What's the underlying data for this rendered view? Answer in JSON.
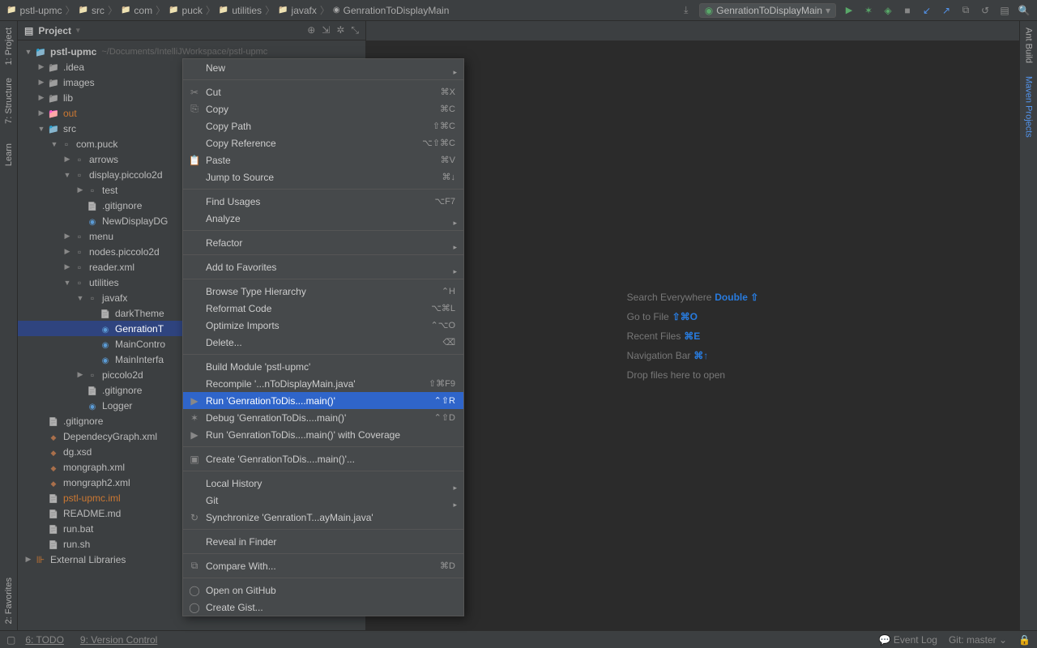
{
  "breadcrumbs": [
    "pstl-upmc",
    "src",
    "com",
    "puck",
    "utilities",
    "javafx",
    "GenrationToDisplayMain"
  ],
  "runConfig": "GenrationToDisplayMain",
  "leftGutter": [
    "1: Project",
    "7: Structure",
    "Learn",
    "2: Favorites"
  ],
  "rightGutter": [
    "Ant Build",
    "Maven Projects"
  ],
  "panelTitle": "Project",
  "tree": [
    {
      "d": 0,
      "a": "▼",
      "i": "folder-blue",
      "t": "pstl-upmc",
      "path": "~/Documents/IntelliJWorkspace/pstl-upmc",
      "bold": true
    },
    {
      "d": 1,
      "a": "▶",
      "i": "folder-icon",
      "t": ".idea"
    },
    {
      "d": 1,
      "a": "▶",
      "i": "folder-icon",
      "t": "images"
    },
    {
      "d": 1,
      "a": "▶",
      "i": "folder-icon",
      "t": "lib"
    },
    {
      "d": 1,
      "a": "▶",
      "i": "folder-orange",
      "t": "out",
      "orange": true
    },
    {
      "d": 1,
      "a": "▼",
      "i": "folder-blue",
      "t": "src"
    },
    {
      "d": 2,
      "a": "▼",
      "i": "pkg-icon",
      "t": "com.puck"
    },
    {
      "d": 3,
      "a": "▶",
      "i": "pkg-icon",
      "t": "arrows"
    },
    {
      "d": 3,
      "a": "▼",
      "i": "pkg-icon",
      "t": "display.piccolo2d"
    },
    {
      "d": 4,
      "a": "▶",
      "i": "pkg-icon",
      "t": "test"
    },
    {
      "d": 4,
      "a": "",
      "i": "file-icon",
      "t": ".gitignore"
    },
    {
      "d": 4,
      "a": "",
      "i": "java-icon",
      "t": "NewDisplayDG"
    },
    {
      "d": 3,
      "a": "▶",
      "i": "pkg-icon",
      "t": "menu"
    },
    {
      "d": 3,
      "a": "▶",
      "i": "pkg-icon",
      "t": "nodes.piccolo2d"
    },
    {
      "d": 3,
      "a": "▶",
      "i": "pkg-icon",
      "t": "reader.xml"
    },
    {
      "d": 3,
      "a": "▼",
      "i": "pkg-icon",
      "t": "utilities"
    },
    {
      "d": 4,
      "a": "▼",
      "i": "pkg-icon",
      "t": "javafx"
    },
    {
      "d": 5,
      "a": "",
      "i": "file-icon",
      "t": "darkTheme"
    },
    {
      "d": 5,
      "a": "",
      "i": "java-icon",
      "t": "GenrationT",
      "sel": true
    },
    {
      "d": 5,
      "a": "",
      "i": "java-icon",
      "t": "MainContro"
    },
    {
      "d": 5,
      "a": "",
      "i": "java-icon",
      "t": "MainInterfa"
    },
    {
      "d": 4,
      "a": "▶",
      "i": "pkg-icon",
      "t": "piccolo2d"
    },
    {
      "d": 4,
      "a": "",
      "i": "file-icon",
      "t": ".gitignore"
    },
    {
      "d": 4,
      "a": "",
      "i": "java-icon",
      "t": "Logger"
    },
    {
      "d": 1,
      "a": "",
      "i": "file-icon",
      "t": ".gitignore"
    },
    {
      "d": 1,
      "a": "",
      "i": "xml-icon",
      "t": "DependecyGraph.xml"
    },
    {
      "d": 1,
      "a": "",
      "i": "xml-icon",
      "t": "dg.xsd"
    },
    {
      "d": 1,
      "a": "",
      "i": "xml-icon",
      "t": "mongraph.xml"
    },
    {
      "d": 1,
      "a": "",
      "i": "xml-icon",
      "t": "mongraph2.xml"
    },
    {
      "d": 1,
      "a": "",
      "i": "file-icon",
      "t": "pstl-upmc.iml",
      "orange": true
    },
    {
      "d": 1,
      "a": "",
      "i": "file-icon",
      "t": "README.md"
    },
    {
      "d": 1,
      "a": "",
      "i": "file-icon",
      "t": "run.bat"
    },
    {
      "d": 1,
      "a": "",
      "i": "file-icon",
      "t": "run.sh"
    },
    {
      "d": 0,
      "a": "▶",
      "i": "lib-icon",
      "t": "External Libraries"
    }
  ],
  "welcome": [
    {
      "t": "Search Everywhere",
      "k": "Double ⇧"
    },
    {
      "t": "Go to File",
      "k": "⇧⌘O"
    },
    {
      "t": "Recent Files",
      "k": "⌘E"
    },
    {
      "t": "Navigation Bar",
      "k": "⌘↑"
    },
    {
      "t": "Drop files here to open",
      "k": ""
    }
  ],
  "menu": [
    {
      "t": "New",
      "sub": true
    },
    {
      "sep": true
    },
    {
      "ic": "✂",
      "t": "Cut",
      "s": "⌘X"
    },
    {
      "ic": "⎘",
      "t": "Copy",
      "s": "⌘C"
    },
    {
      "t": "Copy Path",
      "s": "⇧⌘C"
    },
    {
      "t": "Copy Reference",
      "s": "⌥⇧⌘C"
    },
    {
      "ic": "📋",
      "t": "Paste",
      "s": "⌘V"
    },
    {
      "t": "Jump to Source",
      "s": "⌘↓"
    },
    {
      "sep": true
    },
    {
      "t": "Find Usages",
      "s": "⌥F7"
    },
    {
      "t": "Analyze",
      "sub": true
    },
    {
      "sep": true
    },
    {
      "t": "Refactor",
      "sub": true
    },
    {
      "sep": true
    },
    {
      "t": "Add to Favorites",
      "sub": true
    },
    {
      "sep": true
    },
    {
      "t": "Browse Type Hierarchy",
      "s": "⌃H"
    },
    {
      "t": "Reformat Code",
      "s": "⌥⌘L"
    },
    {
      "t": "Optimize Imports",
      "s": "⌃⌥O"
    },
    {
      "t": "Delete...",
      "s": "⌫"
    },
    {
      "sep": true
    },
    {
      "t": "Build Module 'pstl-upmc'"
    },
    {
      "t": "Recompile '...nToDisplayMain.java'",
      "s": "⇧⌘F9"
    },
    {
      "ic": "▶",
      "t": "Run 'GenrationToDis....main()'",
      "s": "⌃⇧R",
      "hl": true
    },
    {
      "ic": "✶",
      "t": "Debug 'GenrationToDis....main()'",
      "s": "⌃⇧D"
    },
    {
      "ic": "▶",
      "t": "Run 'GenrationToDis....main()' with Coverage"
    },
    {
      "sep": true
    },
    {
      "ic": "▣",
      "t": "Create 'GenrationToDis....main()'..."
    },
    {
      "sep": true
    },
    {
      "t": "Local History",
      "sub": true
    },
    {
      "t": "Git",
      "sub": true
    },
    {
      "ic": "↻",
      "t": "Synchronize 'GenrationT...ayMain.java'"
    },
    {
      "sep": true
    },
    {
      "t": "Reveal in Finder"
    },
    {
      "sep": true
    },
    {
      "ic": "⧉",
      "t": "Compare With...",
      "s": "⌘D"
    },
    {
      "sep": true
    },
    {
      "ic": "◯",
      "t": "Open on GitHub"
    },
    {
      "ic": "◯",
      "t": "Create Gist..."
    }
  ],
  "status": {
    "todo": "6: TODO",
    "vcs": "9: Version Control",
    "eventLog": "Event Log",
    "git": "Git: master"
  }
}
